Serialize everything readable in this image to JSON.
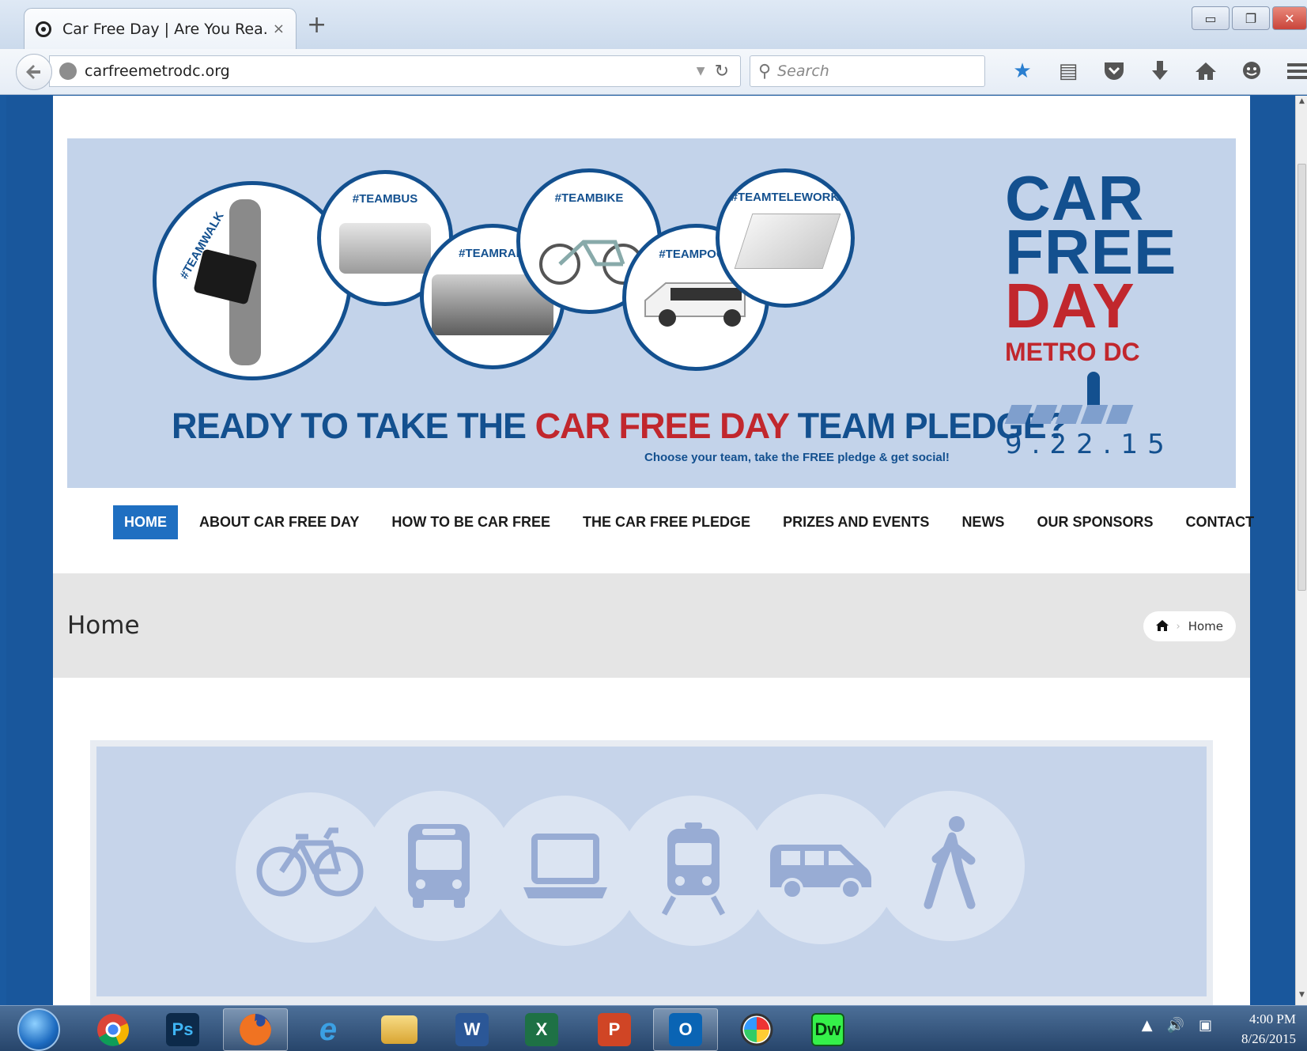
{
  "browser": {
    "tab_title": "Car Free Day | Are You Rea...",
    "tab_close": "×",
    "new_tab": "+",
    "url": "carfreemetrodc.org",
    "search_placeholder": "Search",
    "window_buttons": {
      "minimize": "▭",
      "restore": "❐",
      "close": "✕"
    },
    "toolbar_icons": [
      "star-icon",
      "reading-list-icon",
      "pocket-icon",
      "download-icon",
      "home-icon",
      "chat-icon",
      "menu-icon"
    ]
  },
  "banner": {
    "teams": [
      "#TEAMWALK",
      "#TEAMBUS",
      "#TEAMRAIL",
      "#TEAMBIKE",
      "#TEAMPOOL",
      "#TEAMTELEWORK"
    ],
    "headline_part1": "READY TO TAKE THE ",
    "headline_part2": "CAR FREE DAY",
    "headline_part3": " TEAM PLEDGE?",
    "subline": "Choose your team, take the FREE pledge & get social!",
    "logo": {
      "line1": "CAR",
      "line2": "FREE",
      "line3": "DAY",
      "line4": "METRO DC",
      "date": "9.22.15"
    },
    "colors": {
      "navy": "#13508f",
      "red": "#c1272d",
      "bg": "#c3d3ea"
    }
  },
  "nav": {
    "items": [
      {
        "label": "HOME",
        "active": true
      },
      {
        "label": "ABOUT CAR FREE DAY"
      },
      {
        "label": "HOW TO BE CAR FREE"
      },
      {
        "label": "THE CAR FREE PLEDGE"
      },
      {
        "label": "PRIZES AND EVENTS"
      },
      {
        "label": "NEWS"
      },
      {
        "label": "OUR SPONSORS"
      },
      {
        "label": "CONTACT"
      }
    ]
  },
  "page_header": {
    "title": "Home",
    "breadcrumb_current": "Home"
  },
  "modes": [
    "bike-icon",
    "bus-icon",
    "laptop-icon",
    "train-icon",
    "van-icon",
    "walker-icon"
  ],
  "taskbar": {
    "apps": [
      "chrome",
      "photoshop",
      "firefox",
      "internet-explorer",
      "file-explorer",
      "word",
      "excel",
      "powerpoint",
      "outlook",
      "color-picker",
      "dreamweaver"
    ],
    "time": "4:00 PM",
    "date": "8/26/2015"
  }
}
